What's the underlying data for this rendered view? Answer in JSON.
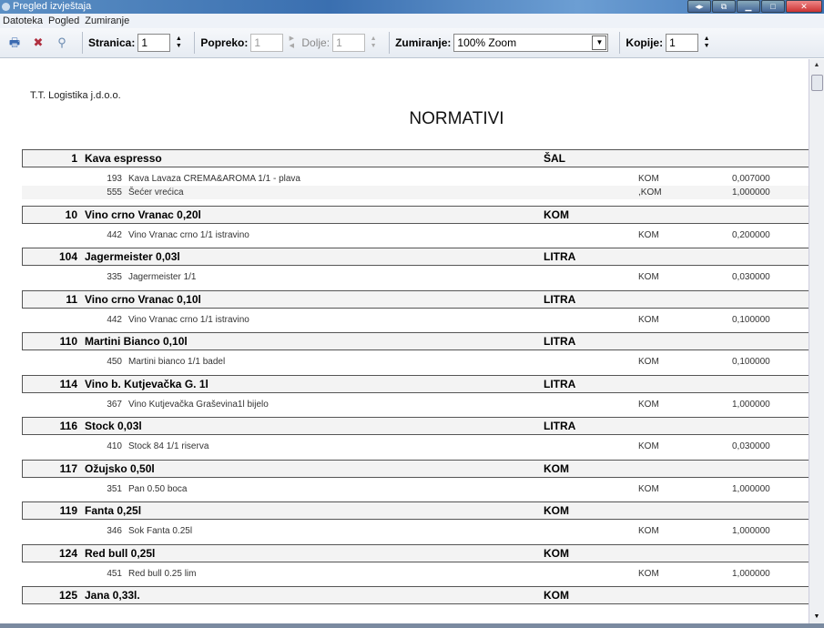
{
  "window": {
    "title": "Pregled izvještaja"
  },
  "menu": [
    "Datoteka",
    "Pogled",
    "Zumiranje"
  ],
  "toolbar": {
    "stranica_label": "Stranica:",
    "stranica_value": "1",
    "popreko_label": "Popreko:",
    "popreko_value": "1",
    "dolje_label": "Dolje:",
    "dolje_value": "1",
    "zumiranje_label": "Zumiranje:",
    "zumiranje_value": "100% Zoom",
    "kopije_label": "Kopije:",
    "kopije_value": "1"
  },
  "report": {
    "company": "T.T. Logistika j.d.o.o.",
    "title": "NORMATIVI",
    "groups": [
      {
        "code": "1",
        "name": "Kava espresso",
        "unit": "ŠAL",
        "items": [
          {
            "code": "193",
            "name": "Kava Lavaza CREMA&AROMA  1/1 - plava",
            "unit": "KOM",
            "qty": "0,007000"
          },
          {
            "code": "555",
            "name": "Šećer vrećica",
            "unit": ",KOM",
            "qty": "1,000000"
          }
        ]
      },
      {
        "code": "10",
        "name": "Vino crno Vranac 0,20l",
        "unit": "KOM",
        "items": [
          {
            "code": "442",
            "name": "Vino  Vranac crno 1/1 istravino",
            "unit": "KOM",
            "qty": "0,200000"
          }
        ]
      },
      {
        "code": "104",
        "name": "Jagermeister 0,03l",
        "unit": "LITRA",
        "items": [
          {
            "code": "335",
            "name": "Jagermeister 1/1",
            "unit": "KOM",
            "qty": "0,030000"
          }
        ]
      },
      {
        "code": "11",
        "name": "Vino crno  Vranac 0,10l",
        "unit": "LITRA",
        "items": [
          {
            "code": "442",
            "name": "Vino  Vranac crno 1/1 istravino",
            "unit": "KOM",
            "qty": "0,100000"
          }
        ]
      },
      {
        "code": "110",
        "name": "Martini Bianco 0,10l",
        "unit": "LITRA",
        "items": [
          {
            "code": "450",
            "name": "Martini bianco 1/1  badel",
            "unit": "KOM",
            "qty": "0,100000"
          }
        ]
      },
      {
        "code": "114",
        "name": "Vino b. Kutjevačka G. 1l",
        "unit": "LITRA",
        "items": [
          {
            "code": "367",
            "name": "Vino Kutjevačka Graševina1l bijelo",
            "unit": "KOM",
            "qty": "1,000000"
          }
        ]
      },
      {
        "code": "116",
        "name": "Stock 0,03l",
        "unit": "LITRA",
        "items": [
          {
            "code": "410",
            "name": "Stock 84 1/1 riserva",
            "unit": "KOM",
            "qty": "0,030000"
          }
        ]
      },
      {
        "code": "117",
        "name": "Ožujsko 0,50l",
        "unit": "KOM",
        "items": [
          {
            "code": "351",
            "name": "Pan 0.50 boca",
            "unit": "KOM",
            "qty": "1,000000"
          }
        ]
      },
      {
        "code": "119",
        "name": "Fanta 0,25l",
        "unit": "KOM",
        "items": [
          {
            "code": "346",
            "name": "Sok Fanta  0.25l",
            "unit": "KOM",
            "qty": "1,000000"
          }
        ]
      },
      {
        "code": "124",
        "name": "Red bull 0,25l",
        "unit": "KOM",
        "items": [
          {
            "code": "451",
            "name": "Red bull  0.25 lim",
            "unit": "KOM",
            "qty": "1,000000"
          }
        ]
      },
      {
        "code": "125",
        "name": "Jana 0,33l.",
        "unit": "KOM",
        "items": []
      }
    ]
  }
}
